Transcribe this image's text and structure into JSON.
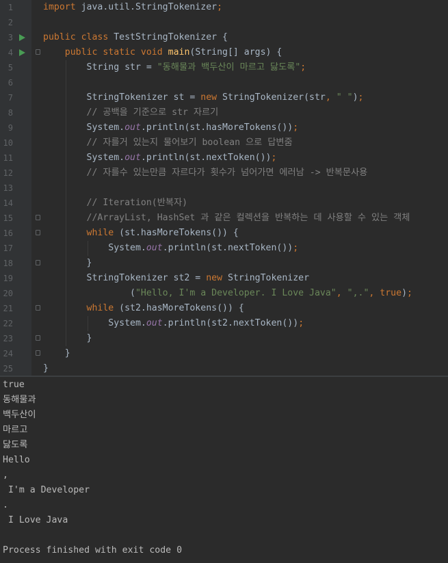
{
  "editor": {
    "lines": [
      {
        "n": "1",
        "segs": [
          {
            "t": "import",
            "c": "kw"
          },
          {
            "t": " java.util.StringTokenizer",
            "c": "plain"
          },
          {
            "t": ";",
            "c": "kw"
          }
        ]
      },
      {
        "n": "2",
        "segs": []
      },
      {
        "n": "3",
        "run": true,
        "segs": [
          {
            "t": "public class ",
            "c": "kw"
          },
          {
            "t": "TestStringTokenizer {",
            "c": "plain"
          }
        ]
      },
      {
        "n": "4",
        "run": true,
        "fold": true,
        "segs": [
          {
            "t": "    public static void ",
            "c": "kw"
          },
          {
            "t": "main",
            "c": "fn"
          },
          {
            "t": "(String[] args) {",
            "c": "plain"
          }
        ]
      },
      {
        "n": "5",
        "segs": [
          {
            "t": "        String str = ",
            "c": "plain"
          },
          {
            "t": "\"동해물과 백두산이 마르고 닳도록\"",
            "c": "str"
          },
          {
            "t": ";",
            "c": "kw"
          }
        ]
      },
      {
        "n": "6",
        "segs": []
      },
      {
        "n": "7",
        "segs": [
          {
            "t": "        StringTokenizer st = ",
            "c": "plain"
          },
          {
            "t": "new ",
            "c": "kw"
          },
          {
            "t": "StringTokenizer(str",
            "c": "plain"
          },
          {
            "t": ", ",
            "c": "kw"
          },
          {
            "t": "\" \"",
            "c": "str"
          },
          {
            "t": ")",
            "c": "plain"
          },
          {
            "t": ";",
            "c": "kw"
          }
        ]
      },
      {
        "n": "8",
        "segs": [
          {
            "t": "        // 공백을 기준으로 str 자르기",
            "c": "cm"
          }
        ]
      },
      {
        "n": "9",
        "segs": [
          {
            "t": "        System.",
            "c": "plain"
          },
          {
            "t": "out",
            "c": "fld"
          },
          {
            "t": ".println(st.hasMoreTokens())",
            "c": "plain"
          },
          {
            "t": ";",
            "c": "kw"
          }
        ]
      },
      {
        "n": "10",
        "segs": [
          {
            "t": "        // 자를거 있는지 물어보기 boolean 으로 답변줌",
            "c": "cm"
          }
        ]
      },
      {
        "n": "11",
        "segs": [
          {
            "t": "        System.",
            "c": "plain"
          },
          {
            "t": "out",
            "c": "fld"
          },
          {
            "t": ".println(st.nextToken())",
            "c": "plain"
          },
          {
            "t": ";",
            "c": "kw"
          }
        ]
      },
      {
        "n": "12",
        "segs": [
          {
            "t": "        // 자를수 있는만큼 자르다가 횟수가 넘어가면 에러남 -> 반복문사용",
            "c": "cm"
          }
        ]
      },
      {
        "n": "13",
        "segs": []
      },
      {
        "n": "14",
        "segs": [
          {
            "t": "        // Iteration(반복자)",
            "c": "cm"
          }
        ]
      },
      {
        "n": "15",
        "fold": true,
        "segs": [
          {
            "t": "        //ArrayList, HashSet 과 같은 컬렉션을 반복하는 데 사용할 수 있는 객체",
            "c": "cm"
          }
        ]
      },
      {
        "n": "16",
        "fold": true,
        "segs": [
          {
            "t": "        while ",
            "c": "kw"
          },
          {
            "t": "(st.hasMoreTokens()) {",
            "c": "plain"
          }
        ]
      },
      {
        "n": "17",
        "segs": [
          {
            "t": "            System.",
            "c": "plain"
          },
          {
            "t": "out",
            "c": "fld"
          },
          {
            "t": ".println(st.nextToken())",
            "c": "plain"
          },
          {
            "t": ";",
            "c": "kw"
          }
        ]
      },
      {
        "n": "18",
        "fold": true,
        "segs": [
          {
            "t": "        }",
            "c": "plain"
          }
        ]
      },
      {
        "n": "19",
        "segs": [
          {
            "t": "        StringTokenizer st2 = ",
            "c": "plain"
          },
          {
            "t": "new ",
            "c": "kw"
          },
          {
            "t": "StringTokenizer",
            "c": "plain"
          }
        ]
      },
      {
        "n": "20",
        "segs": [
          {
            "t": "                (",
            "c": "plain"
          },
          {
            "t": "\"Hello, I'm a Developer. I Love Java\"",
            "c": "str"
          },
          {
            "t": ", ",
            "c": "kw"
          },
          {
            "t": "\",.\"",
            "c": "str"
          },
          {
            "t": ", ",
            "c": "kw"
          },
          {
            "t": "true",
            "c": "kw"
          },
          {
            "t": ")",
            "c": "plain"
          },
          {
            "t": ";",
            "c": "kw"
          }
        ]
      },
      {
        "n": "21",
        "fold": true,
        "segs": [
          {
            "t": "        while ",
            "c": "kw"
          },
          {
            "t": "(st2.hasMoreTokens()) {",
            "c": "plain"
          }
        ]
      },
      {
        "n": "22",
        "segs": [
          {
            "t": "            System.",
            "c": "plain"
          },
          {
            "t": "out",
            "c": "fld"
          },
          {
            "t": ".println(st2.nextToken())",
            "c": "plain"
          },
          {
            "t": ";",
            "c": "kw"
          }
        ]
      },
      {
        "n": "23",
        "fold": true,
        "segs": [
          {
            "t": "        }",
            "c": "plain"
          }
        ]
      },
      {
        "n": "24",
        "fold": true,
        "segs": [
          {
            "t": "    }",
            "c": "plain"
          }
        ]
      },
      {
        "n": "25",
        "segs": [
          {
            "t": "}",
            "c": "plain"
          }
        ]
      }
    ]
  },
  "console": {
    "lines": [
      "true",
      "동해물과",
      "백두산이",
      "마르고",
      "닳도록",
      "Hello",
      ",",
      " I'm a Developer",
      ".",
      " I Love Java",
      "",
      "Process finished with exit code 0"
    ]
  }
}
